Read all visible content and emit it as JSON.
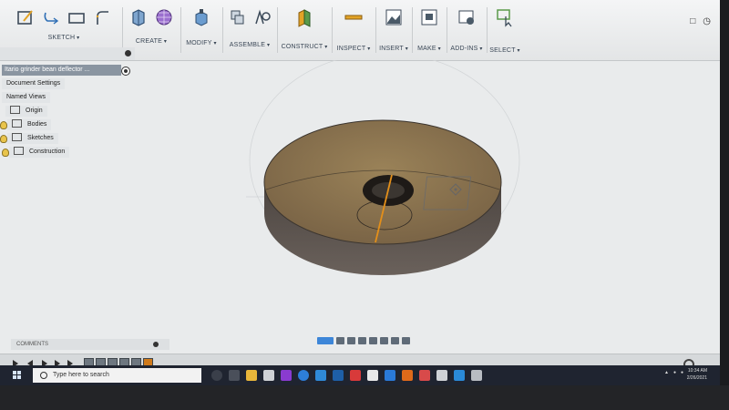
{
  "toolbar": {
    "groups": [
      {
        "label": "SKETCH"
      },
      {
        "label": "CREATE"
      },
      {
        "label": "MODIFY"
      },
      {
        "label": "ASSEMBLE"
      },
      {
        "label": "CONSTRUCT"
      },
      {
        "label": "INSPECT"
      },
      {
        "label": "INSERT"
      },
      {
        "label": "MAKE"
      },
      {
        "label": "ADD-INS"
      },
      {
        "label": "SELECT"
      }
    ],
    "accent": "#3d86d8"
  },
  "browser": {
    "document_name": "Itario grinder bean deflector ...",
    "items": [
      {
        "label": "Document Settings"
      },
      {
        "label": "Named Views"
      },
      {
        "label": "Origin"
      },
      {
        "label": "Bodies"
      },
      {
        "label": "Sketches"
      },
      {
        "label": "Construction"
      }
    ]
  },
  "comments": {
    "label": "COMMENTS"
  },
  "taskbar": {
    "search_placeholder": "Type here to search",
    "clock_time": "10:34 AM",
    "clock_date": "2/26/2021"
  },
  "colors": {
    "body_top": "#8a7450",
    "body_side": "#5d5148",
    "viewport_bg": "#eef0f1"
  }
}
